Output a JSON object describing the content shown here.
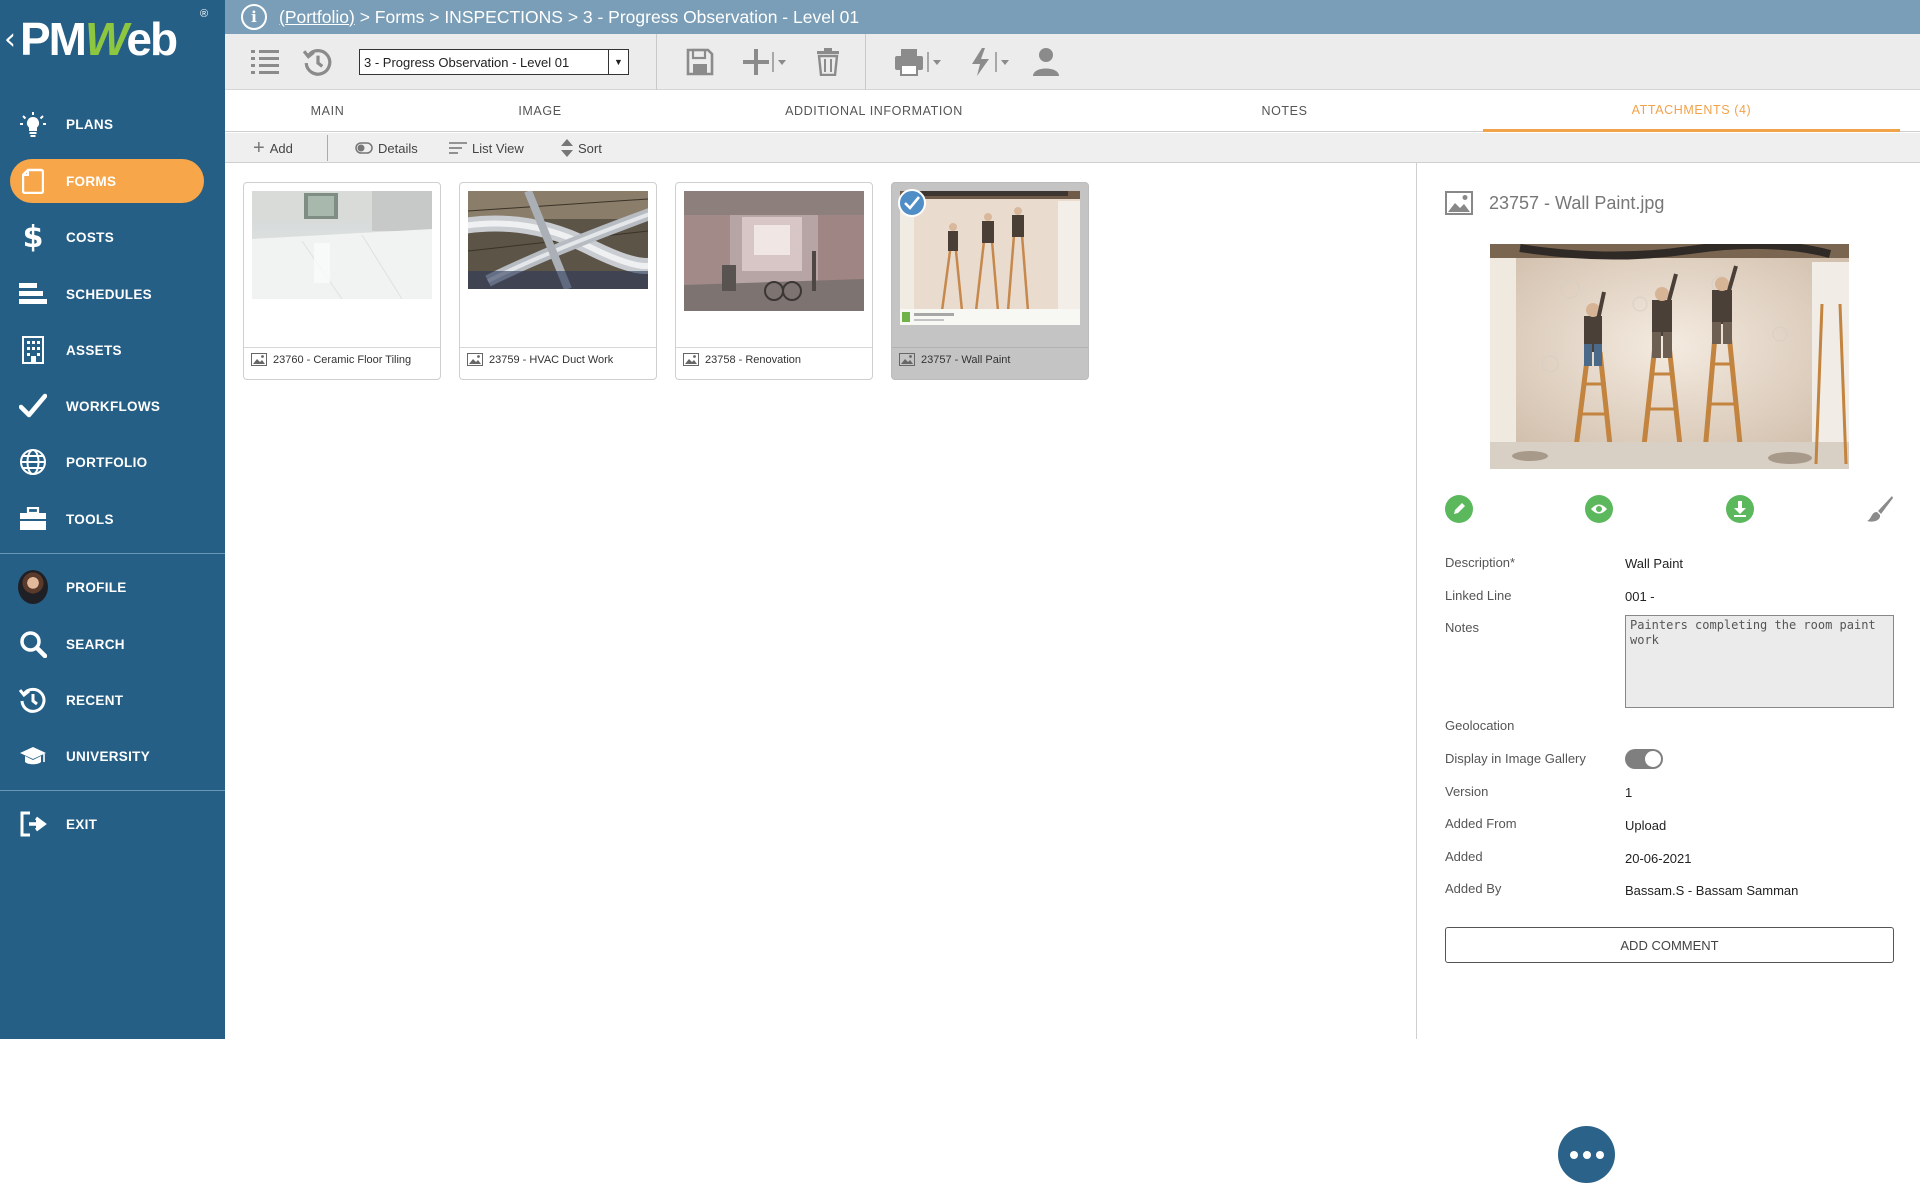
{
  "app": {
    "brand_left": "PM",
    "brand_w": "W",
    "brand_right": "eb",
    "registered": "®"
  },
  "sidebar": {
    "items": [
      {
        "label": "PLANS",
        "icon": "lightbulb-icon"
      },
      {
        "label": "FORMS",
        "icon": "form-icon",
        "active": true
      },
      {
        "label": "COSTS",
        "icon": "dollar-icon"
      },
      {
        "label": "SCHEDULES",
        "icon": "schedule-bars-icon"
      },
      {
        "label": "ASSETS",
        "icon": "building-icon"
      },
      {
        "label": "WORKFLOWS",
        "icon": "checkmark-icon"
      },
      {
        "label": "PORTFOLIO",
        "icon": "globe-icon"
      },
      {
        "label": "TOOLS",
        "icon": "toolbox-icon"
      }
    ],
    "bottom_items": [
      {
        "label": "PROFILE",
        "icon": "avatar"
      },
      {
        "label": "SEARCH",
        "icon": "search-icon"
      },
      {
        "label": "RECENT",
        "icon": "history-icon"
      },
      {
        "label": "UNIVERSITY",
        "icon": "graduation-cap-icon"
      }
    ],
    "exit": {
      "label": "EXIT",
      "icon": "exit-icon"
    }
  },
  "breadcrumb": {
    "portfolio_link": "(Portfolio)",
    "rest": " > Forms > INSPECTIONS > 3 - Progress Observation - Level 01"
  },
  "toolbar": {
    "record_select_value": "3 - Progress Observation - Level 01"
  },
  "tabs": [
    {
      "label": "MAIN"
    },
    {
      "label": "IMAGE"
    },
    {
      "label": "ADDITIONAL INFORMATION"
    },
    {
      "label": "NOTES"
    },
    {
      "label": "ATTACHMENTS (4)",
      "active": true
    }
  ],
  "subbar": {
    "add": "Add",
    "details": "Details",
    "list_view": "List View",
    "sort": "Sort"
  },
  "attachments": [
    {
      "caption": "23760 - Ceramic Floor Tiling",
      "scene": "ceramic-floor-photo"
    },
    {
      "caption": "23759 - HVAC Duct Work",
      "scene": "hvac-duct-photo"
    },
    {
      "caption": "23758 - Renovation",
      "scene": "renovation-photo"
    },
    {
      "caption": "23757 - Wall Paint",
      "scene": "wall-paint-photo",
      "selected": true
    }
  ],
  "detail": {
    "file_name": "23757 - Wall Paint.jpg",
    "actions": [
      "edit-icon",
      "view-icon",
      "download-icon",
      "annotate-brush-icon"
    ],
    "fields": {
      "description_label": "Description*",
      "description_value": "Wall Paint",
      "linked_line_label": "Linked Line",
      "linked_line_value": "001 -",
      "notes_label": "Notes",
      "notes_value": "Painters completing the room paint work",
      "geolocation_label": "Geolocation",
      "display_gallery_label": "Display in Image Gallery",
      "display_gallery_on": true,
      "version_label": "Version",
      "version_value": "1",
      "added_from_label": "Added From",
      "added_from_value": "Upload",
      "added_label": "Added",
      "added_value": "20-06-2021",
      "added_by_label": "Added By",
      "added_by_value": "Bassam.S - Bassam Samman"
    },
    "add_comment": "ADD COMMENT"
  },
  "colors": {
    "sidebar": "#255f86",
    "active_pill": "#f7a64a",
    "titlebar": "#7a9eb7",
    "tab_active": "#f2a34a",
    "action_green": "#5cb85c",
    "fab": "#2b6289"
  }
}
